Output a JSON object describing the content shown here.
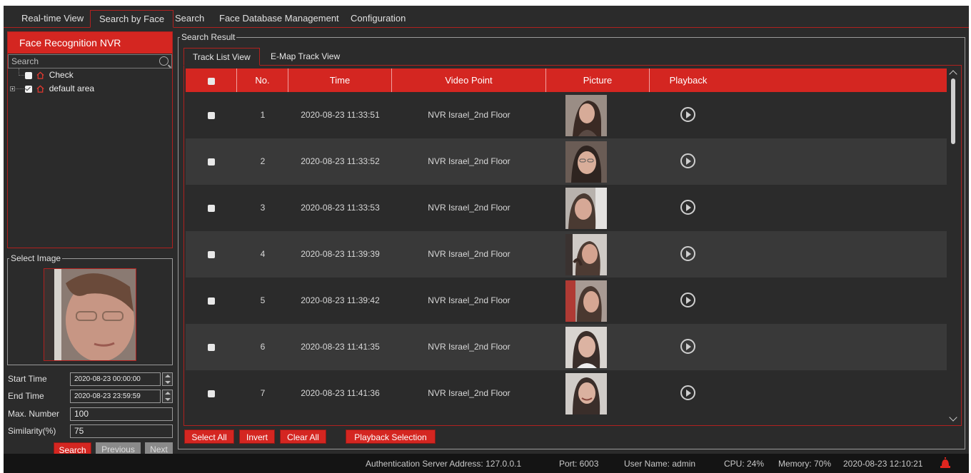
{
  "top_tabs": [
    {
      "label": "Real-time View",
      "active": false
    },
    {
      "label": "Search by Face",
      "active": true
    },
    {
      "label": "Search",
      "active": false
    },
    {
      "label": "Face Database Management",
      "active": false
    },
    {
      "label": "Configuration",
      "active": false
    }
  ],
  "device_panel": {
    "title": "Face Recognition NVR",
    "search_placeholder": "Search",
    "tree": [
      {
        "label": "Check",
        "checked": false,
        "icon": "home-icon"
      },
      {
        "label": "default area",
        "checked": true,
        "icon": "home-icon"
      }
    ]
  },
  "select_image": {
    "legend": "Select Image"
  },
  "form": {
    "start_time_label": "Start Time",
    "start_time_value": "2020-08-23 00:00:00",
    "end_time_label": "End Time",
    "end_time_value": "2020-08-23 23:59:59",
    "max_number_label": "Max. Number",
    "max_number_value": "100",
    "similarity_label": "Similarity(%)",
    "similarity_value": "75",
    "search_button": "Search",
    "previous_button": "Previous",
    "next_button": "Next"
  },
  "result": {
    "legend": "Search Result",
    "view_tabs": [
      {
        "label": "Track List View",
        "active": true
      },
      {
        "label": "E-Map Track View",
        "active": false
      }
    ],
    "columns": [
      "No.",
      "Time",
      "Video Point",
      "Picture",
      "Playback"
    ],
    "rows": [
      {
        "no": "1",
        "time": "2020-08-23 11:33:51",
        "video_point": "NVR Israel_2nd Floor"
      },
      {
        "no": "2",
        "time": "2020-08-23 11:33:52",
        "video_point": "NVR Israel_2nd Floor"
      },
      {
        "no": "3",
        "time": "2020-08-23 11:33:53",
        "video_point": "NVR Israel_2nd Floor"
      },
      {
        "no": "4",
        "time": "2020-08-23 11:39:39",
        "video_point": "NVR Israel_2nd Floor"
      },
      {
        "no": "5",
        "time": "2020-08-23 11:39:42",
        "video_point": "NVR Israel_2nd Floor"
      },
      {
        "no": "6",
        "time": "2020-08-23 11:41:35",
        "video_point": "NVR Israel_2nd Floor"
      },
      {
        "no": "7",
        "time": "2020-08-23 11:41:36",
        "video_point": "NVR Israel_2nd Floor"
      }
    ],
    "buttons": {
      "select_all": "Select All",
      "invert": "Invert",
      "clear_all": "Clear All",
      "playback_selection": "Playback Selection"
    }
  },
  "status": {
    "auth_server": "Authentication Server  Address: 127.0.0.1",
    "port": "Port: 6003",
    "user": "User Name: admin",
    "cpu": "CPU: 24%",
    "memory": "Memory: 70%",
    "datetime": "2020-08-23 12:10:21"
  },
  "colors": {
    "accent": "#d42621",
    "background": "#2b2b2b",
    "row_alt": "#393939",
    "statusbar": "#141414"
  }
}
